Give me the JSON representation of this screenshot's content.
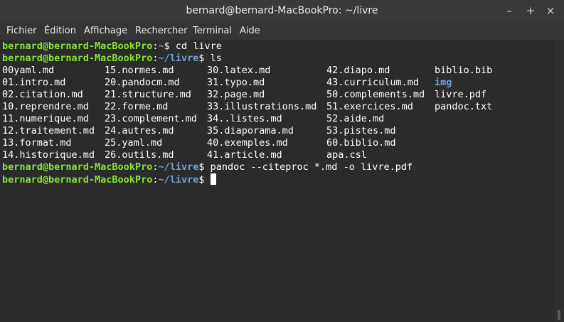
{
  "window": {
    "title": "bernard@bernard-MacBookPro: ~/livre",
    "minimize": "–",
    "maximize": "+",
    "close": "×"
  },
  "menu": [
    "Fichier",
    "Édition",
    "Affichage",
    "Rechercher",
    "Terminal",
    "Aide"
  ],
  "prompt": {
    "user": "bernard@bernard-MacBookPro",
    "home": "~",
    "livre": "~/livre"
  },
  "commands": {
    "cd": "$ cd livre",
    "ls": "$ ls",
    "pandoc": "$ pandoc --citeproc *.md -o livre.pdf",
    "last": "$ "
  },
  "listing": [
    [
      "00yaml.md",
      "15.normes.md",
      "30.latex.md",
      "42.diapo.md",
      "biblio.bib"
    ],
    [
      "01.intro.md",
      "20.pandocm.md",
      "31.typo.md",
      "43.curriculum.md",
      "img"
    ],
    [
      "02.citation.md",
      "21.structure.md",
      "32.page.md",
      "50.complements.md",
      "livre.pdf"
    ],
    [
      "10.reprendre.md",
      "22.forme.md",
      "33.illustrations.md",
      "51.exercices.md",
      "pandoc.txt"
    ],
    [
      "11.numerique.md",
      "23.complement.md",
      "34..listes.md",
      "52.aide.md",
      ""
    ],
    [
      "12.traitement.md",
      "24.autres.md",
      "35.diaporama.md",
      "53.pistes.md",
      ""
    ],
    [
      "13.format.md",
      "25.yaml.md",
      "40.exemples.md",
      "60.biblio.md",
      ""
    ],
    [
      "14.historique.md",
      "26.outils.md",
      "41.article.md",
      "apa.csl",
      ""
    ]
  ],
  "directories": [
    "img"
  ],
  "colors": {
    "prompt_user": "#8ae234",
    "prompt_path": "#729fcf",
    "background": "#2b2b2b"
  }
}
